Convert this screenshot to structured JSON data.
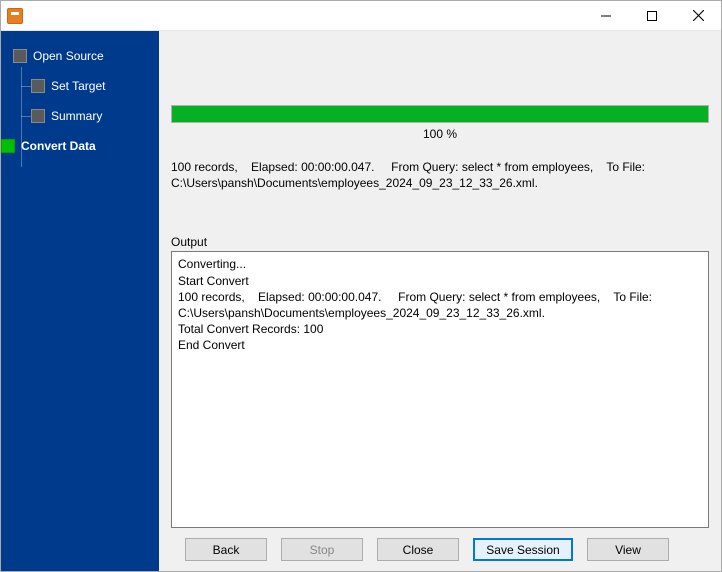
{
  "window": {
    "title": ""
  },
  "sidebar": {
    "items": [
      {
        "label": "Open Source",
        "active": false
      },
      {
        "label": "Set Target",
        "active": false
      },
      {
        "label": "Summary",
        "active": false
      },
      {
        "label": "Convert Data",
        "active": true
      }
    ]
  },
  "progress": {
    "percent": 100,
    "label": "100 %"
  },
  "summary": "100 records,    Elapsed: 00:00:00.047.     From Query: select * from employees,    To File: C:\\Users\\pansh\\Documents\\employees_2024_09_23_12_33_26.xml.",
  "output_label": "Output",
  "output_text": "Converting...\nStart Convert\n100 records,    Elapsed: 00:00:00.047.     From Query: select * from employees,    To File: C:\\Users\\pansh\\Documents\\employees_2024_09_23_12_33_26.xml.\nTotal Convert Records: 100\nEnd Convert",
  "buttons": {
    "back": "Back",
    "stop": "Stop",
    "close": "Close",
    "save_session": "Save Session",
    "view": "View"
  }
}
